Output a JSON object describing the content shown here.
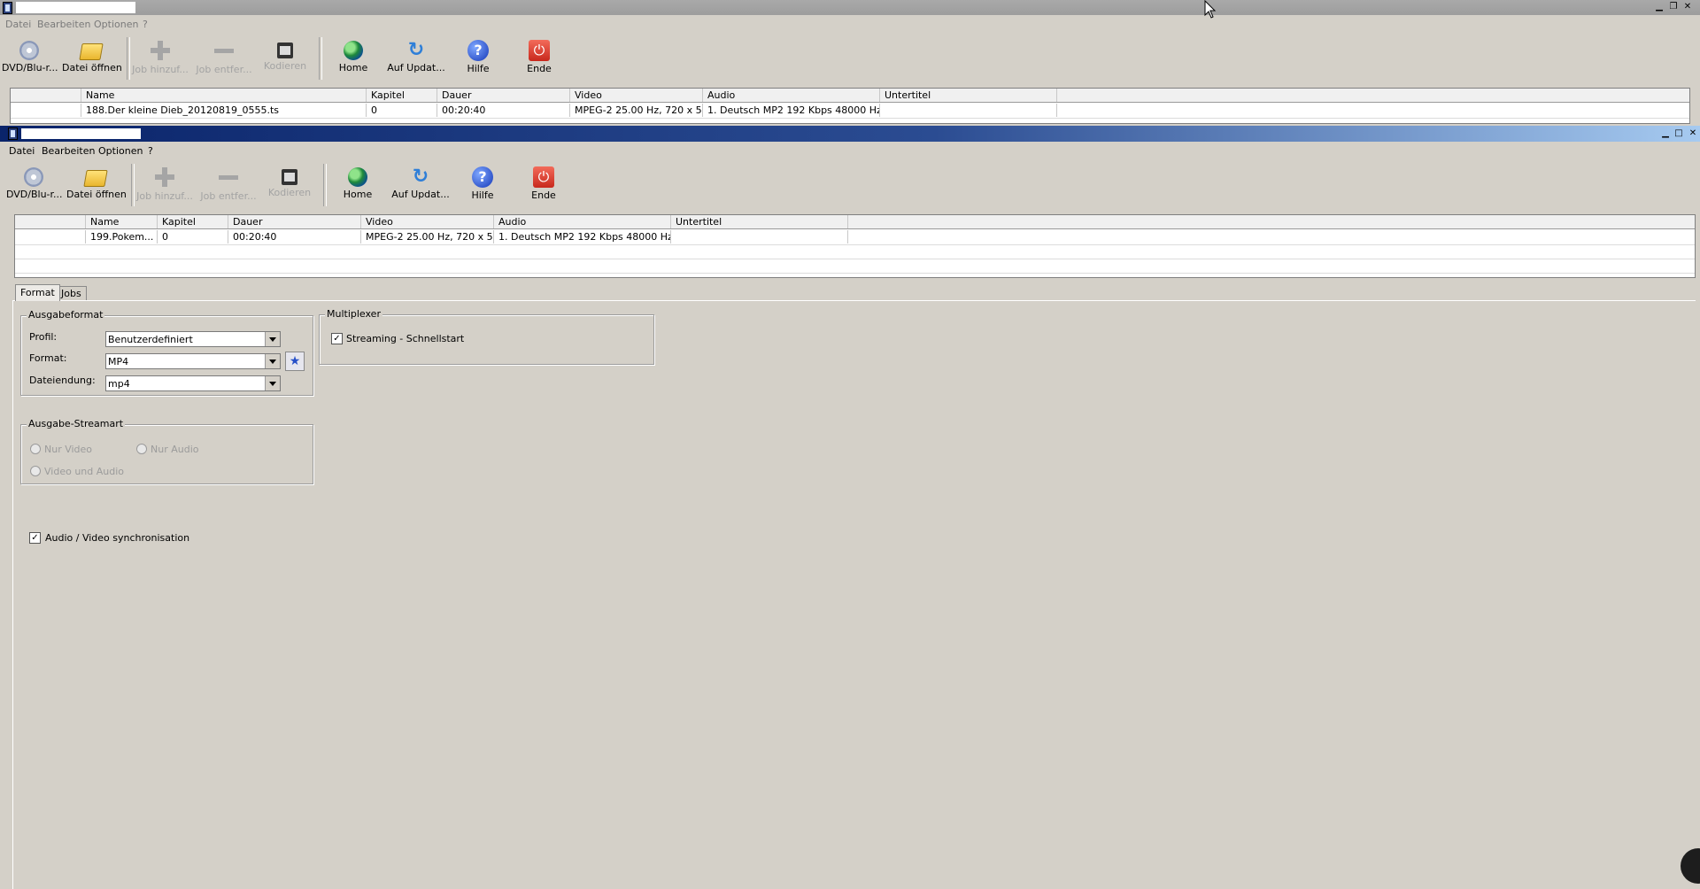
{
  "window1": {
    "menu": [
      "Datei",
      "Bearbeiten",
      "Optionen",
      "?"
    ],
    "toolbar": [
      {
        "label": "DVD/Blu-r...",
        "icon": "disc-icon",
        "disabled": false
      },
      {
        "label": "Datei öffnen",
        "icon": "folder-icon",
        "disabled": false
      },
      {
        "label": "Job hinzuf...",
        "icon": "plus-icon",
        "disabled": true
      },
      {
        "label": "Job entfer...",
        "icon": "minus-icon",
        "disabled": true
      },
      {
        "label": "Kodieren",
        "icon": "film-icon",
        "disabled": true
      },
      {
        "label": "Home",
        "icon": "globe-icon",
        "disabled": false
      },
      {
        "label": "Auf Updat...",
        "icon": "update-icon",
        "disabled": false
      },
      {
        "label": "Hilfe",
        "icon": "help-icon",
        "disabled": false
      },
      {
        "label": "Ende",
        "icon": "power-icon",
        "disabled": false
      }
    ],
    "columns": [
      "",
      "Name",
      "Kapitel",
      "Dauer",
      "Video",
      "Audio",
      "Untertitel",
      ""
    ],
    "rows": [
      [
        "",
        "188.Der kleine Dieb_20120819_0555.ts",
        "0",
        "00:20:40",
        "MPEG-2 25.00 Hz, 720 x 5...",
        "1. Deutsch MP2 192 Kbps 48000 Hz ...",
        "",
        ""
      ]
    ]
  },
  "window2": {
    "menu": [
      "Datei",
      "Bearbeiten",
      "Optionen",
      "?"
    ],
    "toolbar": [
      {
        "label": "DVD/Blu-r...",
        "icon": "disc-icon",
        "disabled": false
      },
      {
        "label": "Datei öffnen",
        "icon": "folder-icon",
        "disabled": false
      },
      {
        "label": "Job hinzuf...",
        "icon": "plus-icon",
        "disabled": true
      },
      {
        "label": "Job entfer...",
        "icon": "minus-icon",
        "disabled": true
      },
      {
        "label": "Kodieren",
        "icon": "film-icon",
        "disabled": true
      },
      {
        "label": "Home",
        "icon": "globe-icon",
        "disabled": false
      },
      {
        "label": "Auf Updat...",
        "icon": "update-icon",
        "disabled": false
      },
      {
        "label": "Hilfe",
        "icon": "help-icon",
        "disabled": false
      },
      {
        "label": "Ende",
        "icon": "power-icon",
        "disabled": false
      }
    ],
    "columns": [
      "",
      "Name",
      "Kapitel",
      "Dauer",
      "Video",
      "Audio",
      "Untertitel",
      ""
    ],
    "rows": [
      [
        "",
        "199.Pokem...",
        "0",
        "00:20:40",
        "MPEG-2 25.00 Hz, 720 x 5...",
        "1. Deutsch MP2 192 Kbps 48000 Hz ...",
        "",
        ""
      ]
    ],
    "tabs": [
      {
        "label": "Format",
        "active": true
      },
      {
        "label": "Jobs",
        "active": false
      }
    ],
    "ausgabeformat": {
      "title": "Ausgabeformat",
      "profil_label": "Profil:",
      "profil_value": "Benutzerdefiniert",
      "format_label": "Format:",
      "format_value": "MP4",
      "ext_label": "Dateiendung:",
      "ext_value": "mp4"
    },
    "multiplexer": {
      "title": "Multiplexer",
      "streaming_label": "Streaming - Schnellstart",
      "streaming_checked": true
    },
    "streamart": {
      "title": "Ausgabe-Streamart",
      "nur_video": "Nur Video",
      "nur_audio": "Nur Audio",
      "video_und_audio": "Video und Audio"
    },
    "sync": {
      "label": "Audio / Video synchronisation",
      "checked": true
    }
  },
  "colors": {
    "face": "#d4d0c8",
    "active_title_start": "#0a246a",
    "active_title_end": "#a6caf0",
    "inactive_title": "#a9a9a9"
  }
}
